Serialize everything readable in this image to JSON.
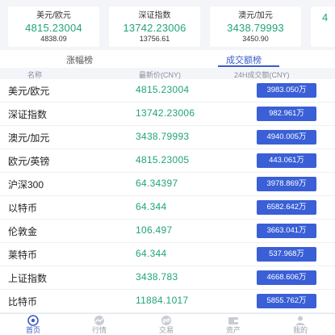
{
  "cards": [
    {
      "name": "美元/欧元",
      "price": "4815.23004",
      "sub": "4838.09"
    },
    {
      "name": "深证指数",
      "price": "13742.23006",
      "sub": "13756.61"
    },
    {
      "name": "澳元/加元",
      "price": "3438.79993",
      "sub": "3450.90"
    },
    {
      "name": "",
      "price": "4",
      "sub": ""
    }
  ],
  "tabs": [
    {
      "label": "涨幅榜"
    },
    {
      "label": "成交额榜"
    }
  ],
  "columns": {
    "name": "名称",
    "price": "最新价(CNY)",
    "volume": "24H成交额(CNY)"
  },
  "rows": [
    {
      "name": "美元/欧元",
      "price": "4815.23004",
      "volume": "3983.050万"
    },
    {
      "name": "深证指数",
      "price": "13742.23006",
      "volume": "982.961万"
    },
    {
      "name": "澳元/加元",
      "price": "3438.79993",
      "volume": "4940.005万"
    },
    {
      "name": "欧元/英镑",
      "price": "4815.23005",
      "volume": "443.061万"
    },
    {
      "name": "沪深300",
      "price": "64.34397",
      "volume": "3978.869万"
    },
    {
      "name": "以特币",
      "price": "64.344",
      "volume": "6582.642万"
    },
    {
      "name": "伦敦金",
      "price": "106.497",
      "volume": "3663.041万"
    },
    {
      "name": "莱特币",
      "price": "64.344",
      "volume": "537.968万"
    },
    {
      "name": "上证指数",
      "price": "3438.783",
      "volume": "4668.606万"
    },
    {
      "name": "比特币",
      "price": "11884.1017",
      "volume": "5855.762万"
    }
  ],
  "tabbar": [
    {
      "label": "首页",
      "icon": "home-icon"
    },
    {
      "label": "行情",
      "icon": "market-icon"
    },
    {
      "label": "交易",
      "icon": "trade-icon"
    },
    {
      "label": "资产",
      "icon": "assets-icon"
    },
    {
      "label": "我的",
      "icon": "profile-icon"
    }
  ],
  "colors": {
    "accent": "#3b5bc8",
    "up": "#20a37a",
    "volume_button": "#3a5fd6"
  }
}
